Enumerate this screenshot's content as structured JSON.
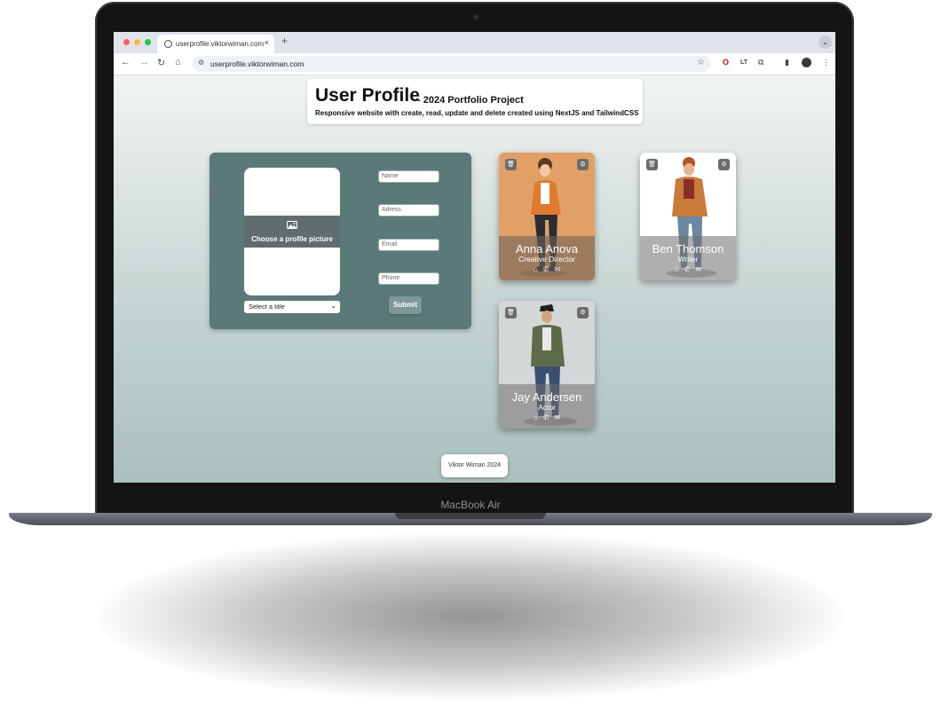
{
  "device": {
    "label": "MacBook Air"
  },
  "browser": {
    "tab_title": "userprofile.viktorwiman.com",
    "url": "userprofile.viktorwiman.com",
    "new_tab": "+",
    "close": "×"
  },
  "header": {
    "title": "User Profile",
    "subtitle": "- 2024 Portfolio Project",
    "description": "Responsive website with create, read, update and delete created using NextJS and TailwindCSS"
  },
  "form": {
    "photo_label": "Choose a profile picture",
    "select_placeholder": "Select a title",
    "fields": {
      "name": "Name",
      "address": "Adress",
      "email": "Email",
      "phone": "Phone"
    },
    "submit": "Submit"
  },
  "cards": [
    {
      "name": "Anna Anova",
      "role": "Creative Director",
      "bg": "#e3a066"
    },
    {
      "name": "Ben Thomson",
      "role": "Writer",
      "bg": "#ffffff"
    },
    {
      "name": "Jay Andersen",
      "role": "Actor",
      "bg": "#d4d7d8"
    }
  ],
  "footer": {
    "text": "Viktor Wiman 2024"
  },
  "colors": {
    "form_bg": "#5b7978",
    "tabbar": "#dfe3ea",
    "accent": "#7d9896"
  }
}
